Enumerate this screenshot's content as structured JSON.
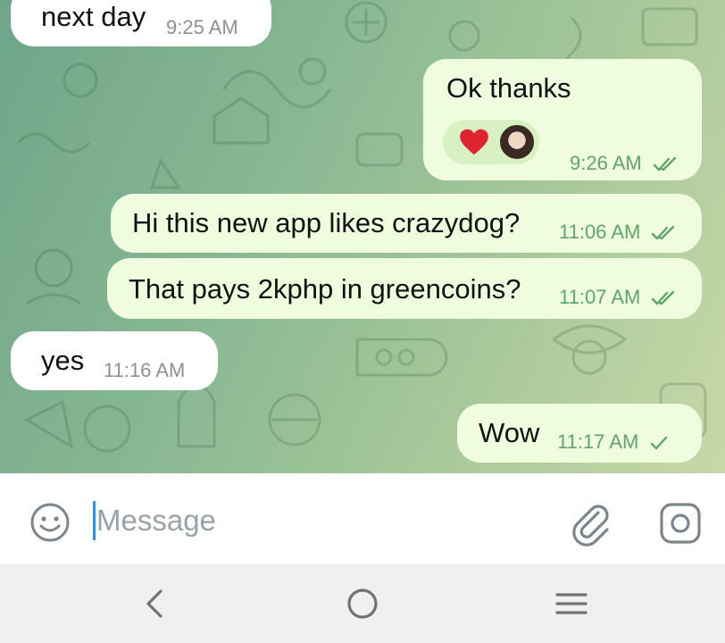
{
  "chat": {
    "messages": [
      {
        "direction": "in",
        "text": "next day",
        "time": "9:25 AM"
      },
      {
        "direction": "out",
        "text": "Ok thanks",
        "time": "9:26 AM",
        "status": "read",
        "reactions": [
          {
            "type": "emoji",
            "icon": "heart-emoji"
          },
          {
            "type": "avatar",
            "icon": "user-avatar"
          }
        ]
      },
      {
        "direction": "out",
        "text": "Hi this new app likes crazydog?",
        "time": "11:06 AM",
        "status": "read"
      },
      {
        "direction": "out",
        "text": "That pays 2kphp in greencoins?",
        "time": "11:07 AM",
        "status": "read"
      },
      {
        "direction": "in",
        "text": "yes",
        "time": "11:16 AM"
      },
      {
        "direction": "out",
        "text": "Wow",
        "time": "11:17 AM",
        "status": "sent"
      }
    ]
  },
  "input": {
    "placeholder": "Message",
    "value": ""
  },
  "colors": {
    "outgoing_bubble": "#effdde",
    "incoming_bubble": "#ffffff",
    "outgoing_meta": "#5fa56a",
    "incoming_meta": "#8b9096",
    "cursor": "#3f8fd6",
    "heart": "#e0242f"
  },
  "icons": {
    "emoji_button": "smiley-icon",
    "attach_button": "paperclip-icon",
    "camera_button": "camera-icon",
    "nav_back": "back-chevron-icon",
    "nav_home": "home-circle-icon",
    "nav_recents": "recents-menu-icon"
  }
}
